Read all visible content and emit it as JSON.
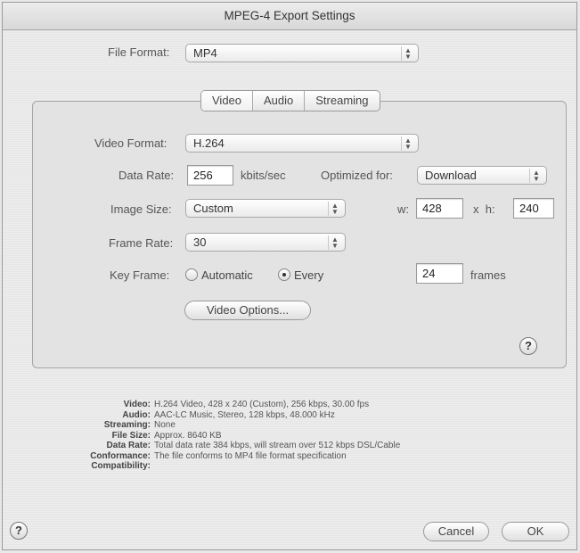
{
  "window": {
    "title": "MPEG-4 Export Settings"
  },
  "file_format": {
    "label": "File Format:",
    "value": "MP4"
  },
  "tabs": [
    {
      "label": "Video",
      "selected": true
    },
    {
      "label": "Audio",
      "selected": false
    },
    {
      "label": "Streaming",
      "selected": false
    }
  ],
  "video": {
    "format_label": "Video Format:",
    "format_value": "H.264",
    "data_rate_label": "Data Rate:",
    "data_rate_value": "256",
    "data_rate_unit": "kbits/sec",
    "optimized_label": "Optimized for:",
    "optimized_value": "Download",
    "image_size_label": "Image Size:",
    "image_size_value": "Custom",
    "w_label": "w:",
    "w_value": "428",
    "h_label": "x  h:",
    "h_value": "240",
    "frame_rate_label": "Frame Rate:",
    "frame_rate_value": "30",
    "key_frame_label": "Key Frame:",
    "key_frame_automatic": "Automatic",
    "key_frame_every": "Every",
    "key_frame_selected": "Every",
    "key_frame_value": "24",
    "key_frame_unit": "frames",
    "options_button": "Video Options..."
  },
  "summary": [
    {
      "key": "Video:",
      "value": "H.264 Video, 428 x 240 (Custom), 256 kbps, 30.00 fps"
    },
    {
      "key": "Audio:",
      "value": "AAC-LC Music, Stereo, 128 kbps, 48.000 kHz"
    },
    {
      "key": "Streaming:",
      "value": "None"
    },
    {
      "key": "File Size:",
      "value": "Approx. 8640 KB"
    },
    {
      "key": "Data Rate:",
      "value": "Total data rate 384 kbps, will stream over 512 kbps DSL/Cable"
    },
    {
      "key": "Conformance:",
      "value": "The file conforms to MP4 file format specification"
    },
    {
      "key": "Compatibility:",
      "value": ""
    }
  ],
  "buttons": {
    "cancel": "Cancel",
    "ok": "OK"
  },
  "help_glyph": "?"
}
